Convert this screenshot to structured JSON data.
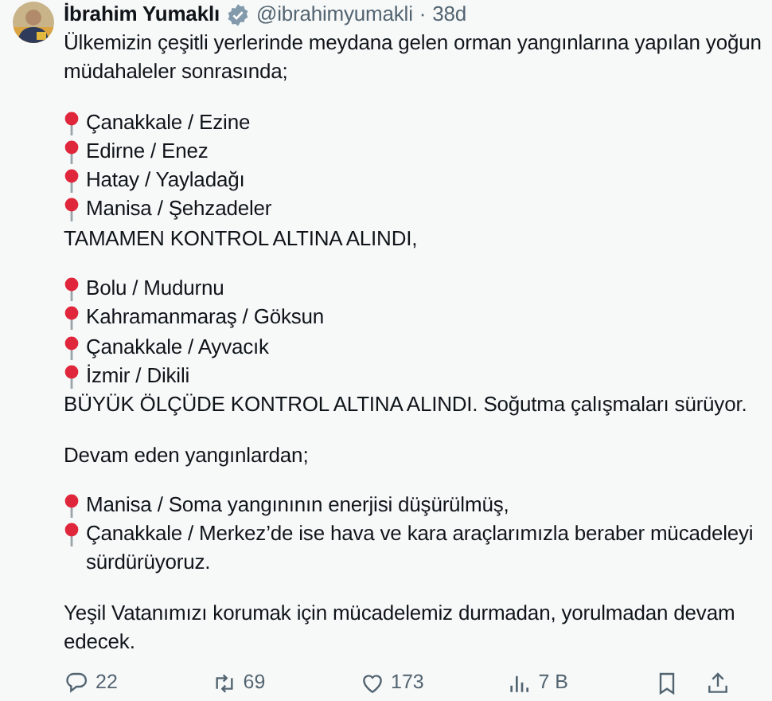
{
  "author": {
    "name": "İbrahim Yumaklı",
    "handle": "@ibrahimyumakli",
    "separator": "·",
    "time": "38d",
    "verified": true
  },
  "body": [
    {
      "kind": "text",
      "text": "Ülkemizin çeşitli yerlerinde meydana gelen orman yangınlarına yapılan yoğun müdahaleler sonrasında;"
    },
    {
      "kind": "gap"
    },
    {
      "kind": "pin",
      "text": "Çanakkale / Ezine"
    },
    {
      "kind": "pin",
      "text": "Edirne / Enez"
    },
    {
      "kind": "pin",
      "text": "Hatay / Yayladağı"
    },
    {
      "kind": "pin",
      "text": "Manisa / Şehzadeler"
    },
    {
      "kind": "text",
      "text": "TAMAMEN KONTROL ALTINA ALINDI,"
    },
    {
      "kind": "gap"
    },
    {
      "kind": "pin",
      "text": "Bolu / Mudurnu"
    },
    {
      "kind": "pin",
      "text": "Kahramanmaraş / Göksun"
    },
    {
      "kind": "pin",
      "text": "Çanakkale / Ayvacık"
    },
    {
      "kind": "pin",
      "text": "İzmir / Dikili"
    },
    {
      "kind": "text",
      "text": "BÜYÜK ÖLÇÜDE KONTROL ALTINA ALINDI. Soğutma çalışmaları sürüyor."
    },
    {
      "kind": "gap"
    },
    {
      "kind": "text",
      "text": "Devam eden yangınlardan;"
    },
    {
      "kind": "gap"
    },
    {
      "kind": "pin",
      "text": "Manisa / Soma yangınının enerjisi düşürülmüş,"
    },
    {
      "kind": "pin",
      "text": "Çanakkale / Merkez’de ise hava ve kara araçlarımızla beraber mücadeleyi sürdürüyoruz."
    },
    {
      "kind": "gap"
    },
    {
      "kind": "text",
      "text": "Yeşil Vatanımızı korumak için mücadelemiz durmadan, yorulmadan devam edecek."
    }
  ],
  "actions": [
    {
      "kind": "reply",
      "count": "22"
    },
    {
      "kind": "repost",
      "count": "69"
    },
    {
      "kind": "like",
      "count": "173"
    },
    {
      "kind": "views",
      "count": "7 B"
    }
  ],
  "extra_actions": [
    {
      "kind": "bookmark"
    },
    {
      "kind": "share"
    }
  ]
}
